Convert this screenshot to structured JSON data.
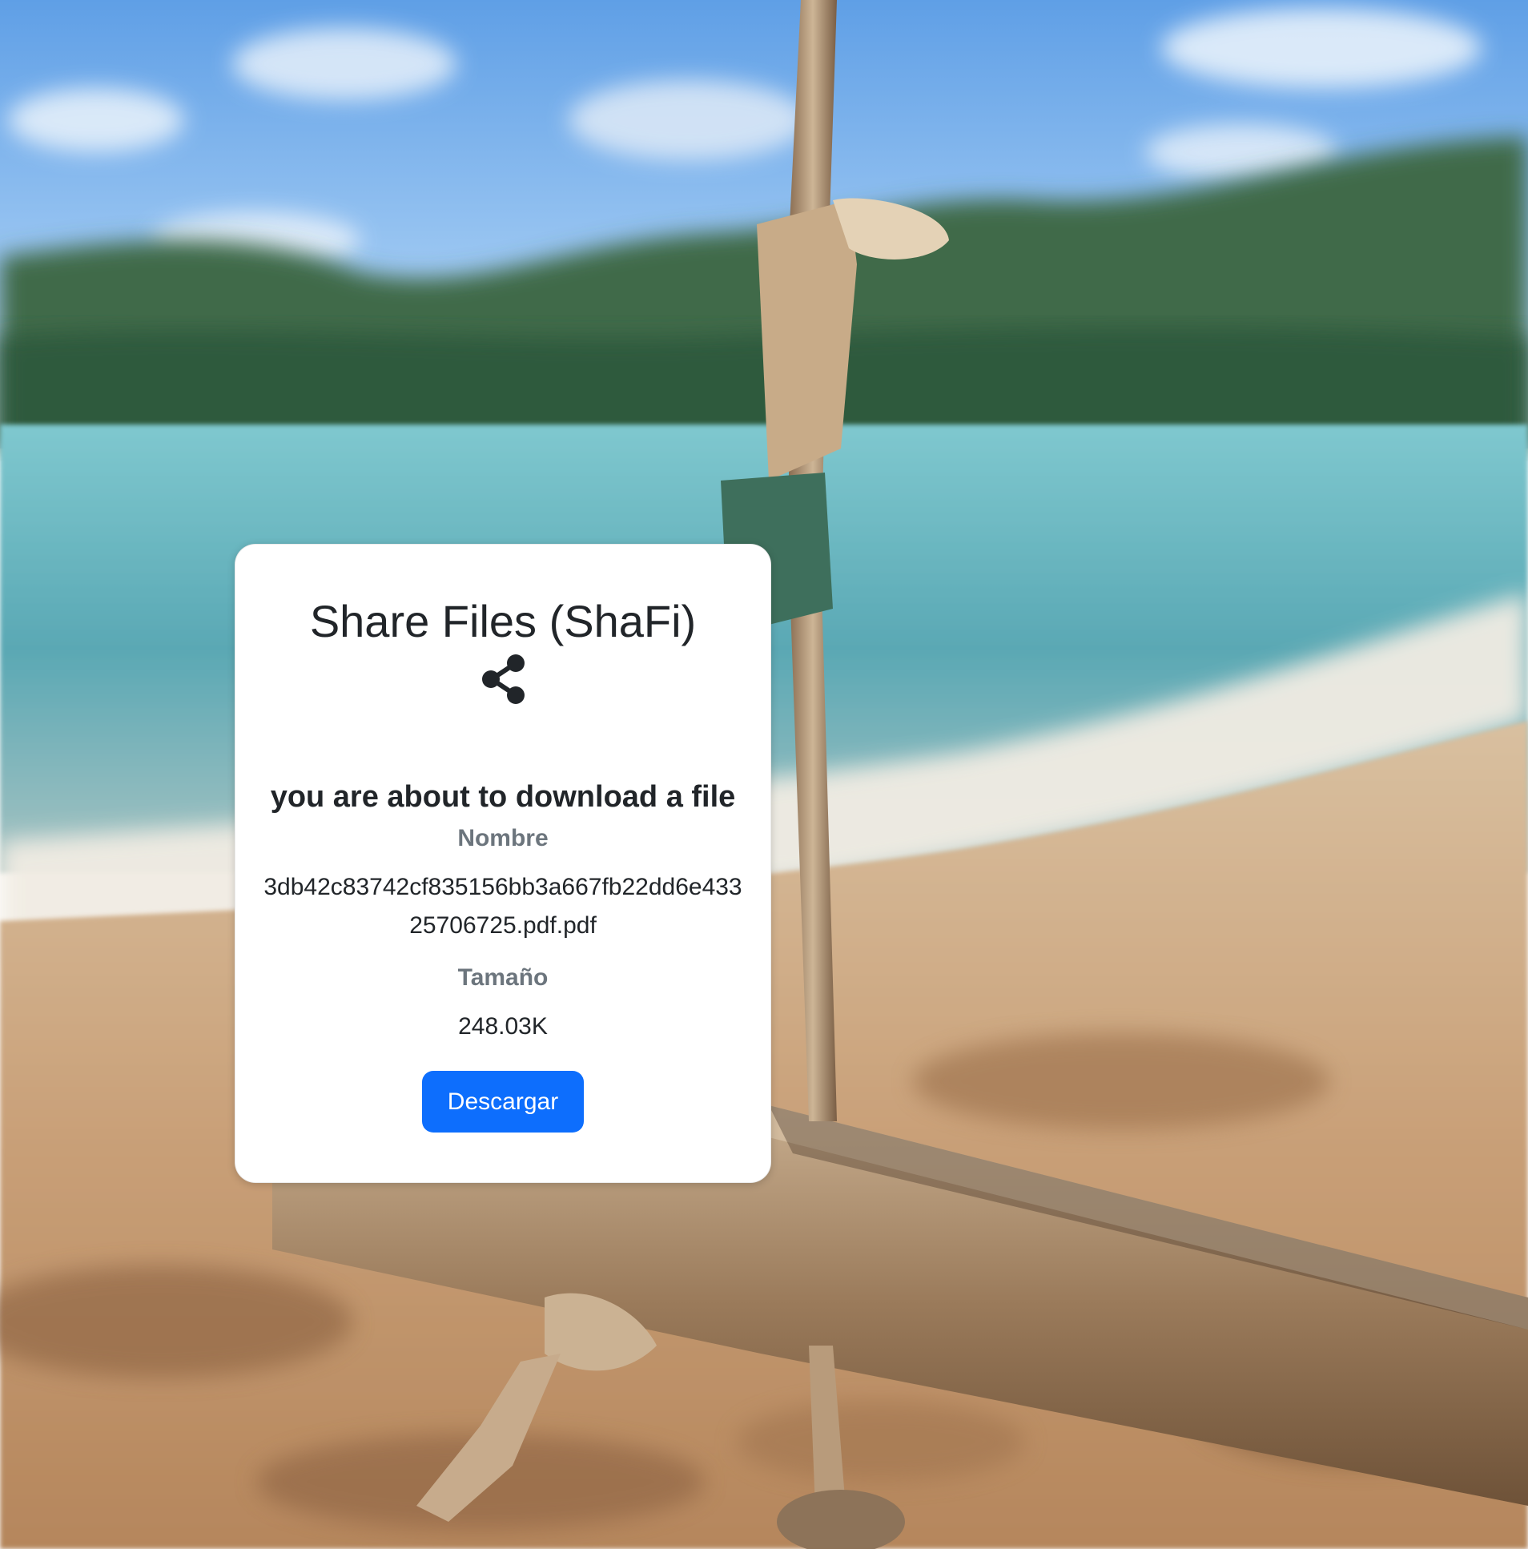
{
  "card": {
    "title": "Share Files (ShaFi)",
    "title_icon": "share-icon",
    "subtitle": "you are about to download a file",
    "name_label": "Nombre",
    "name_value": "3db42c83742cf835156bb3a667fb22dd6e43325706725.pdf.pdf",
    "size_label": "Tamaño",
    "size_value": "248.03K",
    "download_label": "Descargar"
  },
  "colors": {
    "button_bg": "#0d6efd",
    "button_text": "#ffffff",
    "muted_label": "#6c757d",
    "text": "#212529",
    "card_bg": "#ffffff"
  },
  "background": {
    "image": "beach rope swing photo"
  }
}
